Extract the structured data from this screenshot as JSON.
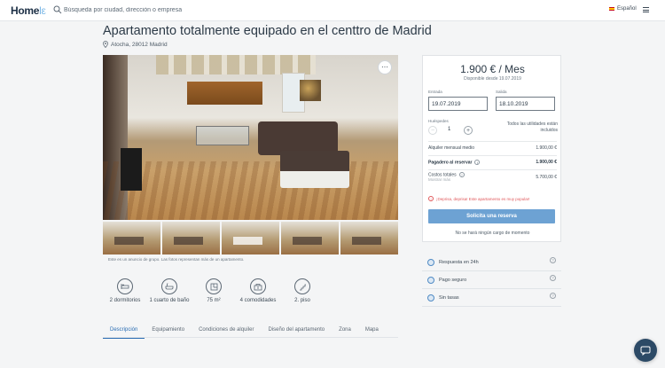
{
  "header": {
    "logo_main": "Home",
    "logo_accent": "lε",
    "search_placeholder": "Búsqueda por ciudad, dirección o empresa",
    "language": "Español"
  },
  "listing": {
    "title": "Apartamento totalmente equipado en el centtro de Madrid",
    "address": "Atocha, 28012 Madrid",
    "photo_caption": "Este es un anuncio de grupo. Las fotos representan más de un apartamento."
  },
  "features": [
    {
      "icon": "bed-icon",
      "label": "2 dormitorios"
    },
    {
      "icon": "bathtub-icon",
      "label": "1 cuarto de baño"
    },
    {
      "icon": "floorplan-icon",
      "label": "75 m²"
    },
    {
      "icon": "amenities-icon",
      "label": "4 comodidades"
    },
    {
      "icon": "stairs-icon",
      "label": "2. piso"
    }
  ],
  "tabs": [
    {
      "label": "Descripción",
      "active": true
    },
    {
      "label": "Equipamiento",
      "active": false
    },
    {
      "label": "Condiciones de alquiler",
      "active": false
    },
    {
      "label": "Diseño del apartamento",
      "active": false
    },
    {
      "label": "Zona",
      "active": false
    },
    {
      "label": "Mapa",
      "active": false
    }
  ],
  "booking": {
    "price": "1.900 € / Mes",
    "available": "Disponible desde 19.07.2019",
    "checkin_label": "Entrada",
    "checkin_value": "19.07.2019",
    "checkout_label": "Salida",
    "checkout_value": "18.10.2019",
    "guests_label": "Huéspedes",
    "guests_value": "1",
    "utilities": "Todos las utilidades están incluidos",
    "monthly_label": "Alquiler mensual medio",
    "monthly_value": "1.900,00 €",
    "pay_label": "Pagadero al reservar",
    "pay_value": "1.900,00 €",
    "total_label": "Costos totales",
    "total_sub": "Mostrar más",
    "total_value": "5.700,00 €",
    "warning": "¡Deprisa, deprisa! Este apartamento es muy popular!",
    "request_button": "Solicita una reserva",
    "no_charge": "No se hará ningún cargo de momento"
  },
  "perks": [
    {
      "label": "Respuesta en 24h"
    },
    {
      "label": "Pago seguro"
    },
    {
      "label": "Sin tasas"
    }
  ],
  "colors": {
    "accent": "#2a6db3",
    "button": "#6da2d3",
    "warning": "#e0585b",
    "chat": "#2c4a66"
  }
}
